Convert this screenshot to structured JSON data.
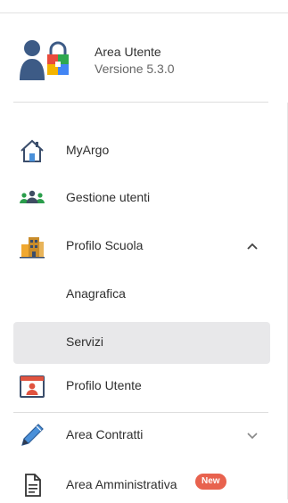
{
  "header": {
    "app_name": "Area Utente",
    "version": "Versione 5.3.0"
  },
  "nav": {
    "myargo": {
      "label": "MyArgo",
      "icon": "home-icon"
    },
    "gestione": {
      "label": "Gestione utenti",
      "icon": "users-group-icon"
    },
    "profilo_scuola": {
      "label": "Profilo Scuola",
      "icon": "building-icon",
      "expanded": true
    },
    "anagrafica": {
      "label": "Anagrafica"
    },
    "servizi": {
      "label": "Servizi",
      "selected": true
    },
    "profilo_utente": {
      "label": "Profilo Utente",
      "icon": "id-card-icon"
    },
    "area_contratti": {
      "label": "Area Contratti",
      "icon": "pen-icon",
      "expanded": false
    },
    "area_amministrativa": {
      "label": "Area Amministrativa",
      "icon": "document-icon",
      "badge": "New"
    }
  },
  "colors": {
    "selected_bg": "#e8e8ea",
    "badge": "#e8624e",
    "logo_person": "#3d5b86"
  }
}
